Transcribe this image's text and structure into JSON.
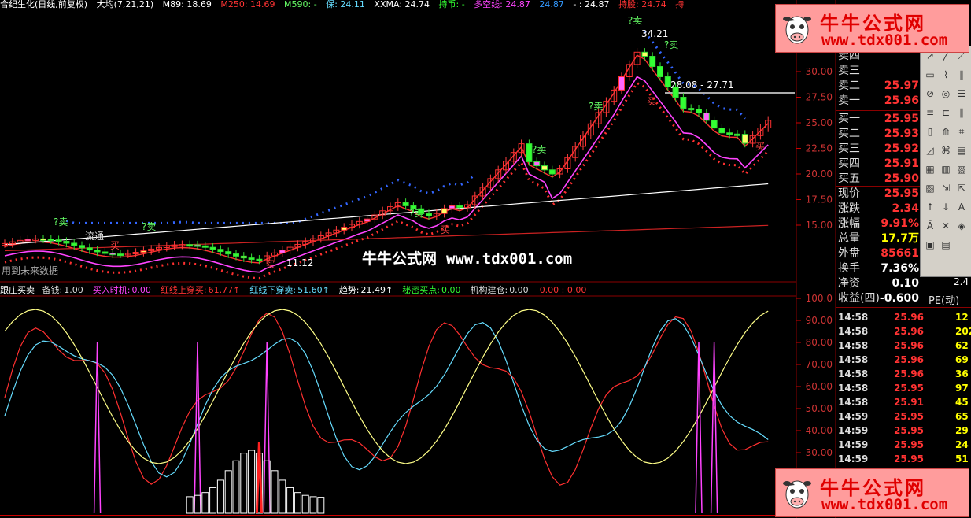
{
  "top_bar": {
    "stock": "合纪生化(日线,前复权)",
    "ma_params": "大均(7,21,21)",
    "m89": "M89: 18.69",
    "m250": "M250: 14.69",
    "m590": "M590: -",
    "bao": "保: 24.11",
    "xxma": "XXMA: 24.74",
    "chi": "持币: -",
    "duokong": "多空线: 24.87",
    "v1": "24.87",
    "v2": "- : 24.87",
    "chigu": "持股: 24.74",
    "chi2": "持"
  },
  "main_chart": {
    "price_axis": [
      "30.00",
      "27.50",
      "25.00",
      "22.50",
      "20.00",
      "17.50",
      "15.00"
    ],
    "annotations": {
      "high": "34.21",
      "resistance": "28.08 - 27.71",
      "low": "11.12",
      "sell": "?卖",
      "buy": "买",
      "future_data": "用到未来数据"
    }
  },
  "indicator": {
    "name": "跟庄买卖",
    "items": [
      {
        "label": "备钱:",
        "value": "1.00",
        "color": "#dddddd"
      },
      {
        "label": "买入时机:",
        "value": "0.00",
        "color": "#ff44ff"
      },
      {
        "label": "红线上穿买:",
        "value": "61.77↑",
        "color": "#ff3333"
      },
      {
        "label": "红线下穿卖:",
        "value": "51.60↑",
        "color": "#66ddff"
      },
      {
        "label": "趋势:",
        "value": "21.49↑",
        "color": "#ffffff"
      },
      {
        "label": "秘密买点:",
        "value": "0.00",
        "color": "#33ff33"
      },
      {
        "label": "机构建仓:",
        "value": "0.00",
        "color": "#dddddd"
      },
      {
        "label": "",
        "value": "0.00 : 0.00",
        "color": "#ff3333"
      }
    ],
    "axis": [
      "100.0",
      "90.00",
      "80.00",
      "70.00",
      "60.00",
      "50.00",
      "40.00",
      "30.00"
    ]
  },
  "quote_panel": {
    "asks": [
      {
        "label": "卖四",
        "price": ""
      },
      {
        "label": "卖三",
        "price": ""
      },
      {
        "label": "卖二",
        "price": "25.97"
      },
      {
        "label": "卖一",
        "price": "25.96"
      }
    ],
    "bids": [
      {
        "label": "买一",
        "price": "25.95"
      },
      {
        "label": "买二",
        "price": "25.93"
      },
      {
        "label": "买三",
        "price": "25.92"
      },
      {
        "label": "买四",
        "price": "25.91"
      },
      {
        "label": "买五",
        "price": "25.90"
      }
    ],
    "stats": [
      {
        "label": "现价",
        "value": "25.95",
        "color": "#ff3333"
      },
      {
        "label": "涨跌",
        "value": "2.34",
        "color": "#ff3333"
      },
      {
        "label": "涨幅",
        "value": "9.91%",
        "color": "#ff3333"
      },
      {
        "label": "总量",
        "value": "17.7万",
        "color": "#ffff00"
      },
      {
        "label": "外盘",
        "value": "85661",
        "color": "#ff3333"
      },
      {
        "label": "换手",
        "value": "7.36%",
        "color": "#ffffff"
      },
      {
        "label": "净资",
        "value": "0.10",
        "color": "#ffffff"
      },
      {
        "label": "收益(四)",
        "value": "-0.600",
        "color": "#ffffff"
      }
    ],
    "extra": {
      "liutong": "流通",
      "liutong_val": "2.4",
      "pe": "PE(动)"
    }
  },
  "ticks": [
    {
      "time": "14:58",
      "price": "25.96",
      "vol": "12"
    },
    {
      "time": "14:58",
      "price": "25.96",
      "vol": "202"
    },
    {
      "time": "14:58",
      "price": "25.96",
      "vol": "62"
    },
    {
      "time": "14:58",
      "price": "25.96",
      "vol": "69"
    },
    {
      "time": "14:58",
      "price": "25.96",
      "vol": "36"
    },
    {
      "time": "14:58",
      "price": "25.95",
      "vol": "97"
    },
    {
      "time": "14:58",
      "price": "25.91",
      "vol": "45"
    },
    {
      "time": "14:59",
      "price": "25.95",
      "vol": "65"
    },
    {
      "time": "14:59",
      "price": "25.95",
      "vol": "29"
    },
    {
      "time": "14:59",
      "price": "25.95",
      "vol": "24"
    },
    {
      "time": "14:59",
      "price": "25.95",
      "vol": "51"
    }
  ],
  "watermark": {
    "title": "牛牛公式网",
    "url": "www.tdx001.com"
  },
  "center_watermark": {
    "title": "牛牛公式网",
    "url": "www.tdx001.com"
  }
}
